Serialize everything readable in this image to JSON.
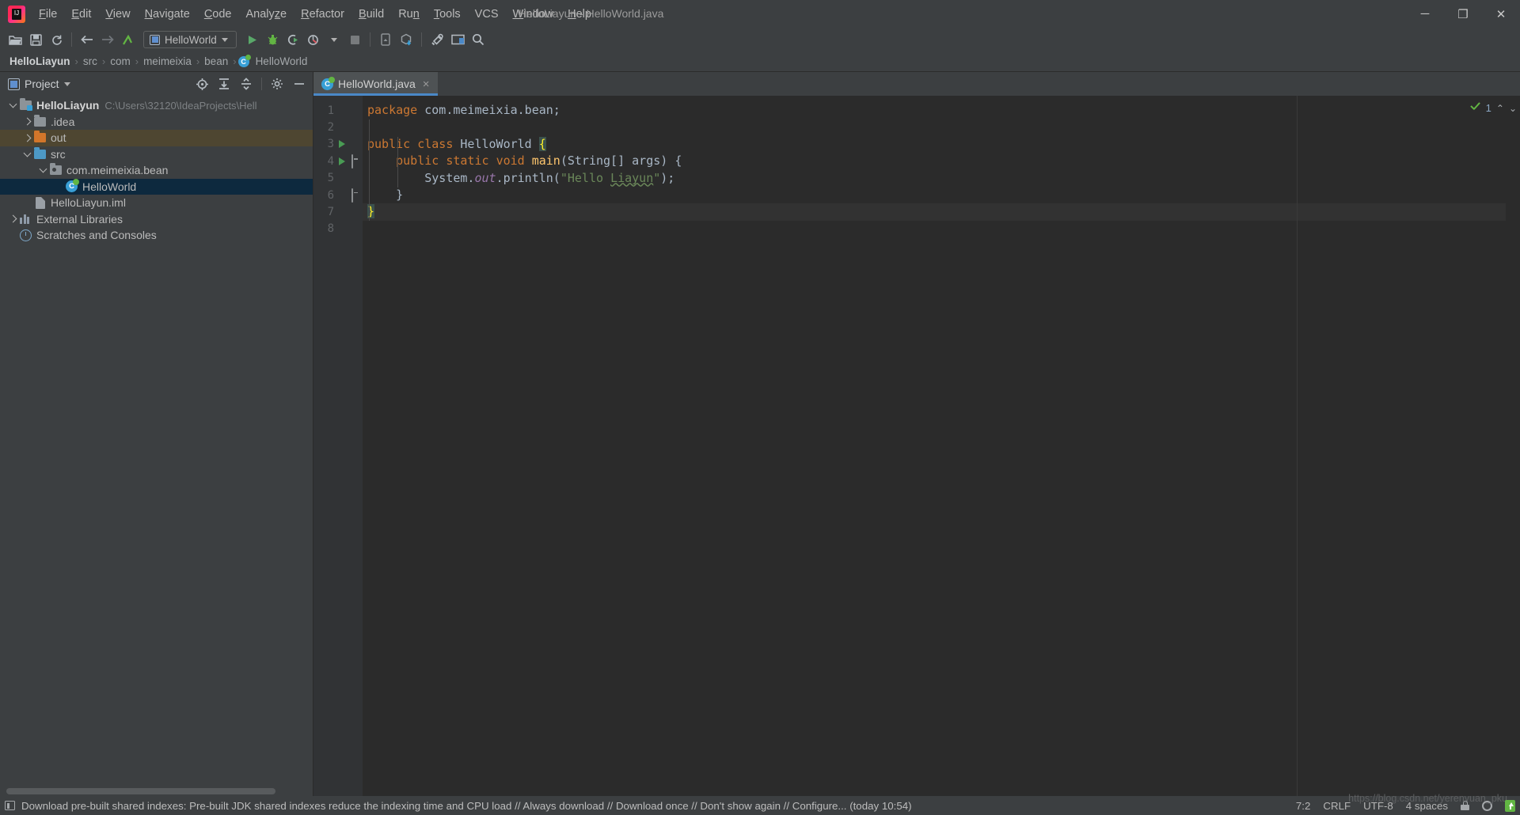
{
  "window": {
    "title": "HelloLiayun - HelloWorld.java",
    "minimize": "─",
    "maximize": "❐",
    "close": "✕"
  },
  "menu": {
    "items": [
      {
        "label": "File",
        "mnemonic": "F",
        "rest": "ile"
      },
      {
        "label": "Edit",
        "mnemonic": "E",
        "rest": "dit"
      },
      {
        "label": "View",
        "mnemonic": "V",
        "rest": "iew"
      },
      {
        "label": "Navigate",
        "mnemonic": "N",
        "rest": "avigate"
      },
      {
        "label": "Code",
        "mnemonic": "C",
        "rest": "ode"
      },
      {
        "label": "Analyze",
        "mnemonic": "z",
        "rest": "Analy",
        "suffix": "e"
      },
      {
        "label": "Refactor",
        "mnemonic": "R",
        "rest": "efactor"
      },
      {
        "label": "Build",
        "mnemonic": "B",
        "rest": "uild"
      },
      {
        "label": "Run",
        "mnemonic": "n",
        "rest": "Ru"
      },
      {
        "label": "Tools",
        "mnemonic": "T",
        "rest": "ools"
      },
      {
        "label": "VCS",
        "mnemonic": "",
        "rest": "VCS"
      },
      {
        "label": "Window",
        "mnemonic": "W",
        "rest": "indow"
      },
      {
        "label": "Help",
        "mnemonic": "H",
        "rest": "elp"
      }
    ]
  },
  "toolbar": {
    "open_label": "open-project",
    "save_label": "save-all",
    "sync_label": "synchronize",
    "back_label": "navigate-back",
    "forward_label": "navigate-forward",
    "build_label": "build-project",
    "run_config": "HelloWorld",
    "run_label": "Run",
    "debug_label": "Debug",
    "run_coverage_label": "Run with Coverage",
    "profile_label": "Profile",
    "stop_label": "Stop",
    "device_label": "device-manager",
    "update_label": "update-project",
    "settings_label": "settings",
    "layout_label": "layout",
    "search_label": "Search Everywhere"
  },
  "breadcrumb": {
    "items": [
      "HelloLiayun",
      "src",
      "com",
      "meimeixia",
      "bean",
      "HelloWorld"
    ],
    "separator": "›"
  },
  "project_panel": {
    "title": "Project",
    "dropdown_caret": "▾",
    "tools": [
      "locate-in-tree",
      "expand-all",
      "collapse-all",
      "settings",
      "hide"
    ],
    "tree": [
      {
        "label": "HelloLiayun",
        "path": "C:\\Users\\32120\\IdeaProjects\\Hell",
        "icon": "project-folder",
        "depth": 0,
        "twisty": "down",
        "bold": true,
        "state": "normal"
      },
      {
        "label": ".idea",
        "path": "",
        "icon": "folder-gray",
        "depth": 1,
        "twisty": "right",
        "bold": false,
        "state": "normal"
      },
      {
        "label": "out",
        "path": "",
        "icon": "folder-orange",
        "depth": 1,
        "twisty": "right",
        "bold": false,
        "state": "highlight"
      },
      {
        "label": "src",
        "path": "",
        "icon": "folder-blue",
        "depth": 1,
        "twisty": "down",
        "bold": false,
        "state": "normal"
      },
      {
        "label": "com.meimeixia.bean",
        "path": "",
        "icon": "package",
        "depth": 2,
        "twisty": "down",
        "bold": false,
        "state": "normal"
      },
      {
        "label": "HelloWorld",
        "path": "",
        "icon": "java-class",
        "depth": 3,
        "twisty": "none",
        "bold": false,
        "state": "selected"
      },
      {
        "label": "HelloLiayun.iml",
        "path": "",
        "icon": "iml-file",
        "depth": 1,
        "twisty": "none",
        "bold": false,
        "state": "normal"
      },
      {
        "label": "External Libraries",
        "path": "",
        "icon": "library",
        "depth": 0,
        "twisty": "right",
        "bold": false,
        "state": "normal"
      },
      {
        "label": "Scratches and Consoles",
        "path": "",
        "icon": "scratch",
        "depth": 0,
        "twisty": "none",
        "bold": false,
        "state": "normal"
      }
    ]
  },
  "editor": {
    "tab": {
      "label": "HelloWorld.java",
      "close": "×"
    },
    "lines": [
      {
        "num": "1",
        "marker": "none",
        "fold": "none",
        "current": false
      },
      {
        "num": "2",
        "marker": "none",
        "fold": "none",
        "current": false
      },
      {
        "num": "3",
        "marker": "run",
        "fold": "none",
        "current": false
      },
      {
        "num": "4",
        "marker": "run",
        "fold": "open",
        "current": false
      },
      {
        "num": "5",
        "marker": "none",
        "fold": "none",
        "current": false
      },
      {
        "num": "6",
        "marker": "none",
        "fold": "close",
        "current": false
      },
      {
        "num": "7",
        "marker": "none",
        "fold": "none",
        "current": true
      },
      {
        "num": "8",
        "marker": "none",
        "fold": "none",
        "current": false
      }
    ],
    "code": {
      "l1_kw": "package",
      "l1_rest": " com.meimeixia.bean;",
      "l3_kw1": "public",
      "l3_kw2": "class",
      "l3_name": "HelloWorld",
      "l3_brace": "{",
      "l4_kw1": "public",
      "l4_kw2": "static",
      "l4_kw3": "void",
      "l4_name": "main",
      "l4_rest": "(String[] args) {",
      "l5_sys": "System.",
      "l5_out": "out",
      "l5_print": ".println(",
      "l5_str_open": "\"Hello ",
      "l5_typo": "Liayun",
      "l5_str_close": "\"",
      "l5_end": ");",
      "l6_brace": "}",
      "l7_brace": "}"
    },
    "inspection": {
      "count": "1",
      "up": "⌃",
      "down": "⌄"
    }
  },
  "statusbar": {
    "message": "Download pre-built shared indexes: Pre-built JDK shared indexes reduce the indexing time and CPU load // Always download // Download once // Don't show again // Configure... (today 10:54)",
    "caret_position": "7:2",
    "line_separator": "CRLF",
    "encoding": "UTF-8",
    "indent": "4 spaces",
    "watermark": "https://blog.csdn.net/yerenyuan_pku"
  },
  "colors": {
    "accent_blue": "#4a88c7",
    "selection": "#0d293e",
    "highlight": "#4e4631",
    "keyword": "#cc7832",
    "string": "#6a8759",
    "field": "#9876aa",
    "method": "#ffc66d",
    "green": "#62b543",
    "panel_bg": "#3c3f41",
    "editor_bg": "#2b2b2b"
  }
}
